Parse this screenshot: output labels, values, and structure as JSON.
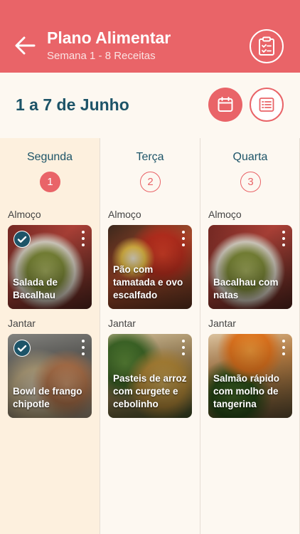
{
  "header": {
    "title": "Plano Alimentar",
    "subtitle": "Semana 1 - 8 Receitas",
    "back_icon": "arrow-left-icon",
    "action_icon": "clipboard-check-icon"
  },
  "week": {
    "date_range": "1 a 7 de Junho",
    "calendar_icon": "calendar-icon",
    "list_icon": "list-icon"
  },
  "colors": {
    "accent": "#e96468",
    "text_dark": "#1d5468",
    "active_day_bg": "#fdf0de",
    "page_bg": "#fdf8f1"
  },
  "days": [
    {
      "name": "Segunda",
      "number": "1",
      "selected": true,
      "meals": [
        {
          "label": "Almoço",
          "recipe": "Salada de Bacalhau",
          "checked": true
        },
        {
          "label": "Jantar",
          "recipe": "Bowl de frango chipotle",
          "checked": true
        }
      ]
    },
    {
      "name": "Terça",
      "number": "2",
      "selected": false,
      "meals": [
        {
          "label": "Almoço",
          "recipe": "Pão com tamatada e ovo escalfado",
          "checked": false
        },
        {
          "label": "Jantar",
          "recipe": "Pasteis de arroz com curgete e cebolinho",
          "checked": false
        }
      ]
    },
    {
      "name": "Quarta",
      "number": "3",
      "selected": false,
      "meals": [
        {
          "label": "Almoço",
          "recipe": "Bacalhau com natas",
          "checked": false
        },
        {
          "label": "Jantar",
          "recipe": "Salmão rápido com molho de tangerina",
          "checked": false
        }
      ]
    }
  ]
}
